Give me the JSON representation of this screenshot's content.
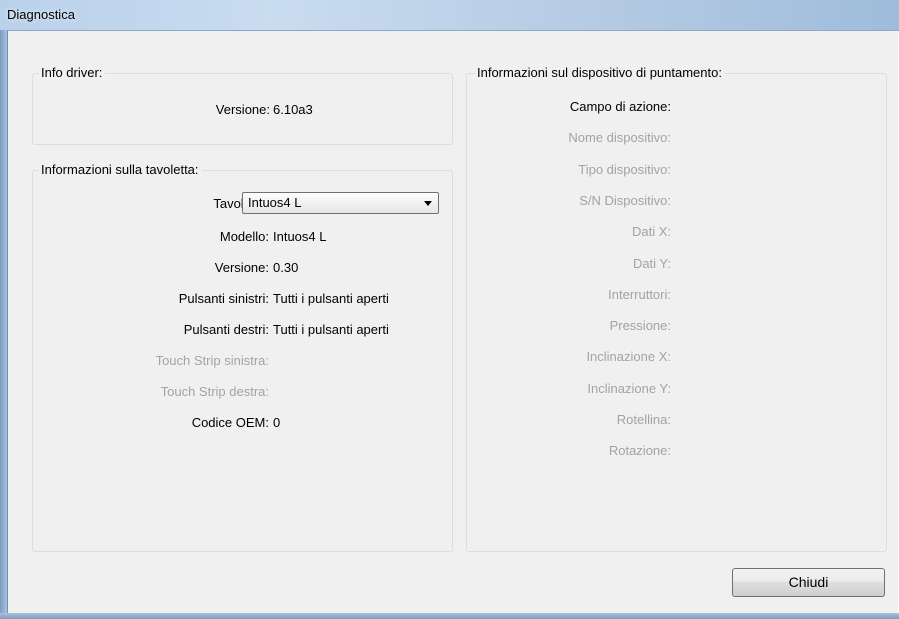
{
  "window": {
    "title": "Diagnostica"
  },
  "driver_info": {
    "legend": "Info driver:",
    "version_label": "Versione:",
    "version_value": "6.10a3"
  },
  "tablet_info": {
    "legend": "Informazioni sulla tavoletta:",
    "tablet_label": "Tavoletta:",
    "tablet_selected": "Intuos4 L",
    "rows": [
      {
        "label": "Modello:",
        "value": "Intuos4 L",
        "enabled": true
      },
      {
        "label": "Versione:",
        "value": "0.30",
        "enabled": true
      },
      {
        "label": "Pulsanti sinistri:",
        "value": "Tutti i pulsanti aperti",
        "enabled": true
      },
      {
        "label": "Pulsanti destri:",
        "value": "Tutti i pulsanti aperti",
        "enabled": true
      },
      {
        "label": "Touch Strip sinistra:",
        "value": "",
        "enabled": false
      },
      {
        "label": "Touch Strip destra:",
        "value": "",
        "enabled": false
      },
      {
        "label": "Codice OEM:",
        "value": "0",
        "enabled": true
      }
    ]
  },
  "pointer_info": {
    "legend": "Informazioni sul dispositivo di puntamento:",
    "rows": [
      {
        "label": "Campo di azione:",
        "enabled": true
      },
      {
        "label": "Nome dispositivo:",
        "enabled": false
      },
      {
        "label": "Tipo dispositivo:",
        "enabled": false
      },
      {
        "label": "S/N Dispositivo:",
        "enabled": false
      },
      {
        "label": "Dati X:",
        "enabled": false
      },
      {
        "label": "Dati Y:",
        "enabled": false
      },
      {
        "label": "Interruttori:",
        "enabled": false
      },
      {
        "label": "Pressione:",
        "enabled": false
      },
      {
        "label": "Inclinazione X:",
        "enabled": false
      },
      {
        "label": "Inclinazione Y:",
        "enabled": false
      },
      {
        "label": "Rotellina:",
        "enabled": false
      },
      {
        "label": "Rotazione:",
        "enabled": false
      }
    ]
  },
  "footer": {
    "close_label": "Chiudi"
  },
  "icons": {
    "dropdown_arrow": "chevron-down-icon"
  }
}
